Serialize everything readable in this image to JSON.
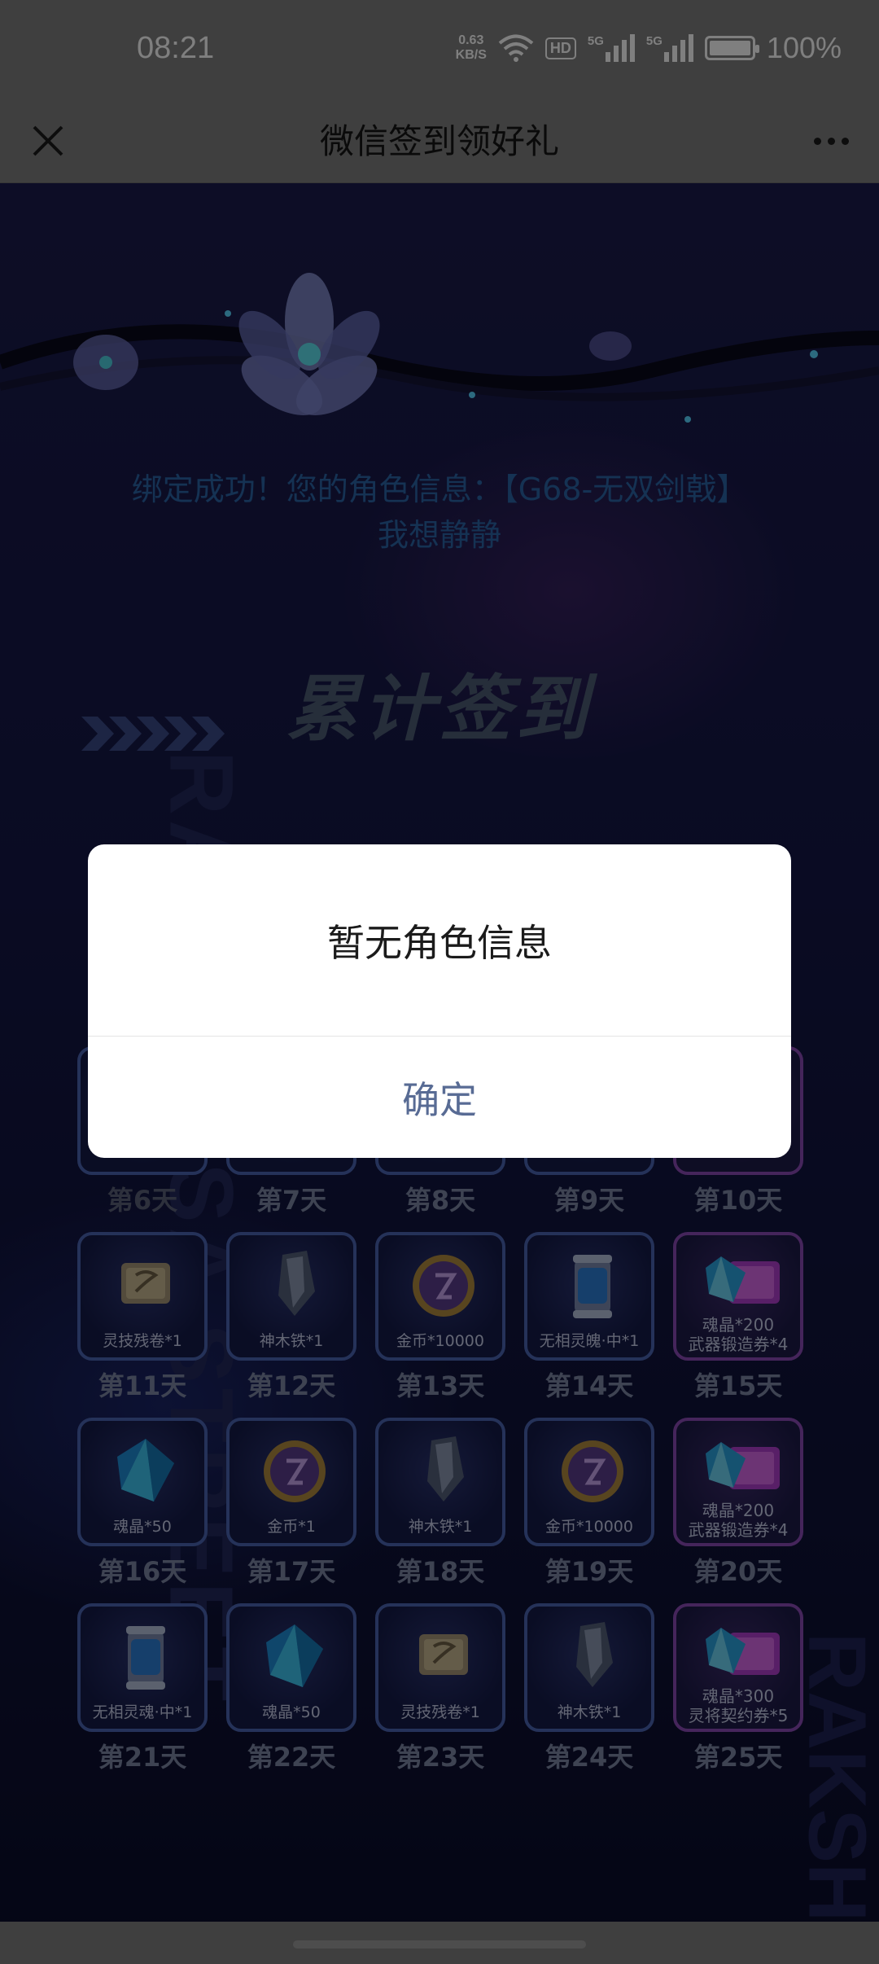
{
  "status_bar": {
    "time": "08:21",
    "net_speed_value": "0.63",
    "net_speed_unit": "KB/S",
    "hd_badge": "HD",
    "signal_1": "5G",
    "signal_2": "5G",
    "battery": "100%",
    "battery_level": 1.0
  },
  "nav": {
    "title": "微信签到领好礼",
    "close_icon": "close-icon",
    "more_icon": "more-icon"
  },
  "page": {
    "bind_info_line1": "绑定成功！您的角色信息：【G68-无双剑戟】",
    "bind_info_line2": "我想静静",
    "section_title": "累计签到",
    "side_text_left": "RAKSHASA STREET",
    "side_text_right": "RAKSH"
  },
  "days": [
    {
      "label": "第6天",
      "item": "",
      "dim": true
    },
    {
      "label": "第7天",
      "item": ""
    },
    {
      "label": "第8天",
      "item": ""
    },
    {
      "label": "第9天",
      "item": ""
    },
    {
      "label": "第10天",
      "item": "",
      "special": true
    },
    {
      "label": "第11天",
      "item": "灵技残卷*1",
      "icon": "scroll-icon"
    },
    {
      "label": "第12天",
      "item": "神木铁*1",
      "icon": "metal-icon"
    },
    {
      "label": "第13天",
      "item": "金币*10000",
      "icon": "coin-icon"
    },
    {
      "label": "第14天",
      "item": "无相灵魄·中*1",
      "icon": "canister-icon"
    },
    {
      "label": "第15天",
      "item": "魂晶*200\n武器锻造券*4",
      "icon": "crystal-ticket-icon",
      "special": true
    },
    {
      "label": "第16天",
      "item": "魂晶*50",
      "icon": "crystal-icon"
    },
    {
      "label": "第17天",
      "item": "金币*1",
      "icon": "coin-icon"
    },
    {
      "label": "第18天",
      "item": "神木铁*1",
      "icon": "metal-icon"
    },
    {
      "label": "第19天",
      "item": "金币*10000",
      "icon": "coin-icon"
    },
    {
      "label": "第20天",
      "item": "魂晶*200\n武器锻造券*4",
      "icon": "crystal-ticket-icon",
      "special": true
    },
    {
      "label": "第21天",
      "item": "无相灵魂·中*1",
      "icon": "canister-icon"
    },
    {
      "label": "第22天",
      "item": "魂晶*50",
      "icon": "crystal-icon"
    },
    {
      "label": "第23天",
      "item": "灵技残卷*1",
      "icon": "scroll-icon"
    },
    {
      "label": "第24天",
      "item": "神木铁*1",
      "icon": "metal-icon"
    },
    {
      "label": "第25天",
      "item": "魂晶*300\n灵将契约券*5",
      "icon": "crystal-ticket-icon",
      "special": true
    }
  ],
  "dialog": {
    "message": "暂无角色信息",
    "confirm": "确定"
  },
  "colors": {
    "accent_link": "#586b94",
    "bind_text": "#2a65a6",
    "tile_border": "#4b64b3",
    "tile_special_border": "#8a4bb6"
  }
}
